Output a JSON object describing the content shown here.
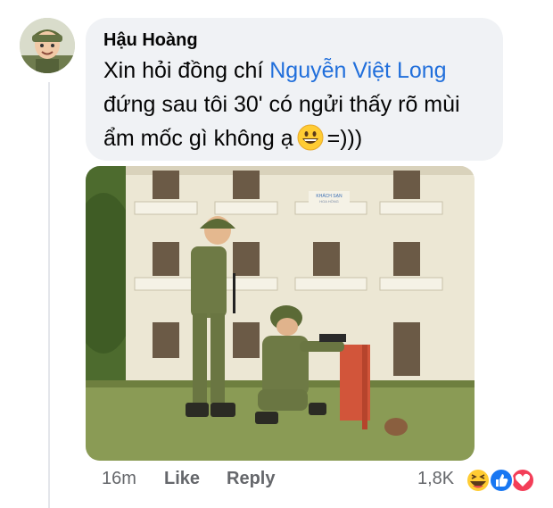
{
  "comment": {
    "author": "Hậu Hoàng",
    "text_before": "Xin hỏi đồng chí ",
    "mention": "Nguyễn Việt Long",
    "text_line2": "đứng sau tôi 30' có ngửi thấy rõ mùi",
    "text_line3_a": "ẩm mốc gì không ạ",
    "text_line3_b": "=)))",
    "emoji": "grinning-face-icon"
  },
  "photo": {
    "sign_line1": "KHÁCH SẠN",
    "sign_line2": "HOA HỒNG"
  },
  "actions": {
    "time": "16m",
    "like_label": "Like",
    "reply_label": "Reply",
    "reaction_count": "1,8K",
    "reactions": [
      "laughing-icon",
      "like-icon",
      "love-icon"
    ]
  },
  "colors": {
    "mention": "#216fdb",
    "bubble": "#f0f2f5",
    "meta": "#65676b"
  }
}
